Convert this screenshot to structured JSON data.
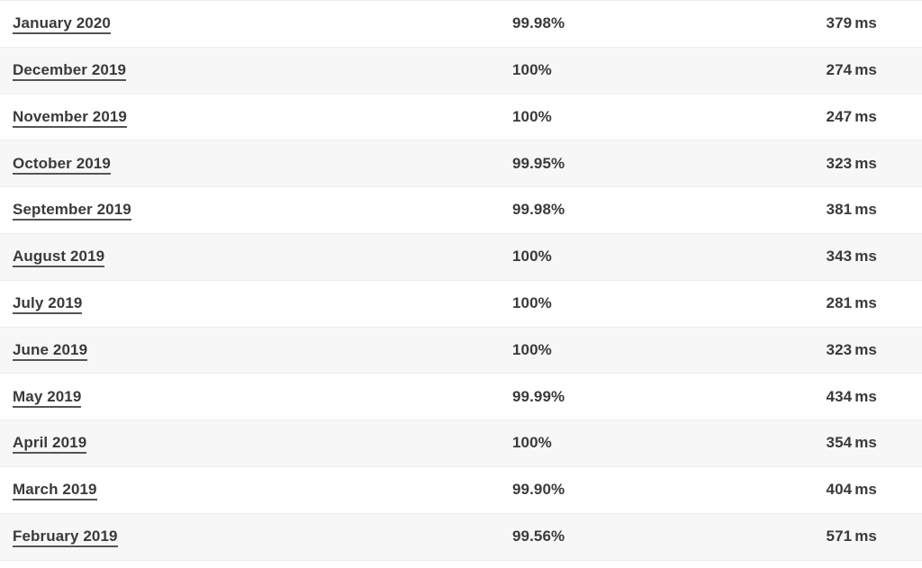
{
  "table": {
    "name": "uptime-history-table",
    "columns": [
      {
        "key": "month",
        "align": "left"
      },
      {
        "key": "uptime",
        "align": "left"
      },
      {
        "key": "response_time",
        "align": "right"
      }
    ],
    "row_unit_label": "ms",
    "colors": {
      "row_background": "#ffffff",
      "row_background_striped": "#f7f7f7",
      "divider": "#ededed",
      "text": "#3a3a3a",
      "link_underline": "#555555"
    },
    "rows": [
      {
        "month": "January 2020",
        "uptime": "99.98%",
        "response_value": "379",
        "response_unit": "ms",
        "striped": false
      },
      {
        "month": "December 2019",
        "uptime": "100%",
        "response_value": "274",
        "response_unit": "ms",
        "striped": true
      },
      {
        "month": "November 2019",
        "uptime": "100%",
        "response_value": "247",
        "response_unit": "ms",
        "striped": false
      },
      {
        "month": "October 2019",
        "uptime": "99.95%",
        "response_value": "323",
        "response_unit": "ms",
        "striped": true
      },
      {
        "month": "September 2019",
        "uptime": "99.98%",
        "response_value": "381",
        "response_unit": "ms",
        "striped": false
      },
      {
        "month": "August 2019",
        "uptime": "100%",
        "response_value": "343",
        "response_unit": "ms",
        "striped": true
      },
      {
        "month": "July 2019",
        "uptime": "100%",
        "response_value": "281",
        "response_unit": "ms",
        "striped": false
      },
      {
        "month": "June 2019",
        "uptime": "100%",
        "response_value": "323",
        "response_unit": "ms",
        "striped": true
      },
      {
        "month": "May 2019",
        "uptime": "99.99%",
        "response_value": "434",
        "response_unit": "ms",
        "striped": false
      },
      {
        "month": "April 2019",
        "uptime": "100%",
        "response_value": "354",
        "response_unit": "ms",
        "striped": true
      },
      {
        "month": "March 2019",
        "uptime": "99.90%",
        "response_value": "404",
        "response_unit": "ms",
        "striped": false
      },
      {
        "month": "February 2019",
        "uptime": "99.56%",
        "response_value": "571",
        "response_unit": "ms",
        "striped": true
      }
    ]
  }
}
